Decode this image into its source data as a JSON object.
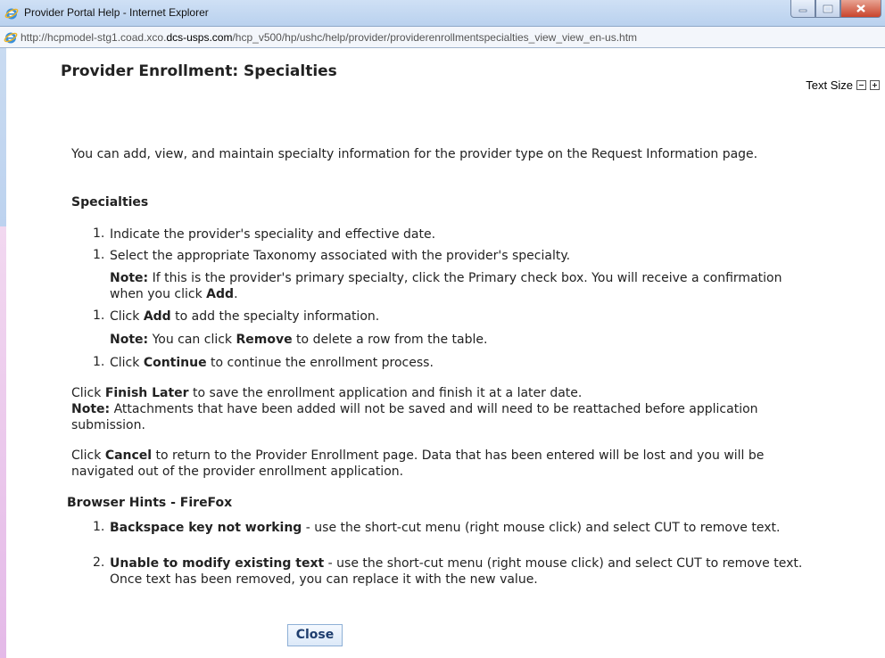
{
  "window": {
    "title": "Provider Portal Help - Internet Explorer",
    "url_prefix": "http://hcpmodel-stg1.coad.xco.",
    "url_domain": "dcs-usps.com",
    "url_path": "/hcp_v500/hp/ushc/help/provider/providerenrollmentspecialties_view_view_en-us.htm"
  },
  "toolbar": {
    "text_size_label": "Text Size"
  },
  "page": {
    "heading": "Provider Enrollment: Specialties",
    "intro": "You can add, view, and maintain specialty information for the provider type on the Request Information page.",
    "section_heading": "Specialties",
    "steps": [
      {
        "number": "1.",
        "text": "Indicate the provider's speciality and effective date."
      },
      {
        "number": "1.",
        "text": "Select the appropriate Taxonomy associated with the provider's specialty."
      },
      {
        "number": "1.",
        "pre": "Click ",
        "bold": "Add",
        "post": " to add the specialty information."
      },
      {
        "number": "1.",
        "pre": "Click ",
        "bold": "Continue",
        "post": " to continue the enrollment process."
      }
    ],
    "note1": {
      "label": "Note:",
      "pre": " If this is the provider's primary specialty, click the Primary check box. You will receive a confirmation when you click ",
      "bold": "Add",
      "post": "."
    },
    "note2": {
      "label": "Note:",
      "pre": " You can click ",
      "bold": "Remove",
      "post": " to delete a row from the table."
    },
    "finish_later": {
      "pre": "Click ",
      "bold": "Finish Later",
      "post": " to save the enrollment application and finish it at a later date."
    },
    "note3": {
      "label": "Note:",
      "text": " Attachments that have been added will not be saved and will need to be reattached before application submission."
    },
    "cancel": {
      "pre": "Click ",
      "bold": "Cancel",
      "post": " to return to the Provider Enrollment page. Data that has been entered will be lost and you will be navigated out of the provider enrollment application."
    },
    "hints_heading": "Browser Hints - FireFox",
    "hints": [
      {
        "number": "1.",
        "bold": "Backspace key not working",
        "text": " - use the short-cut menu (right mouse click) and select CUT to remove text."
      },
      {
        "number": "2.",
        "bold": "Unable to modify existing text",
        "text": " - use the short-cut menu (right mouse click) and select CUT to remove text.  Once text has been removed, you can replace it with the new value."
      }
    ],
    "close_label": "Close"
  }
}
